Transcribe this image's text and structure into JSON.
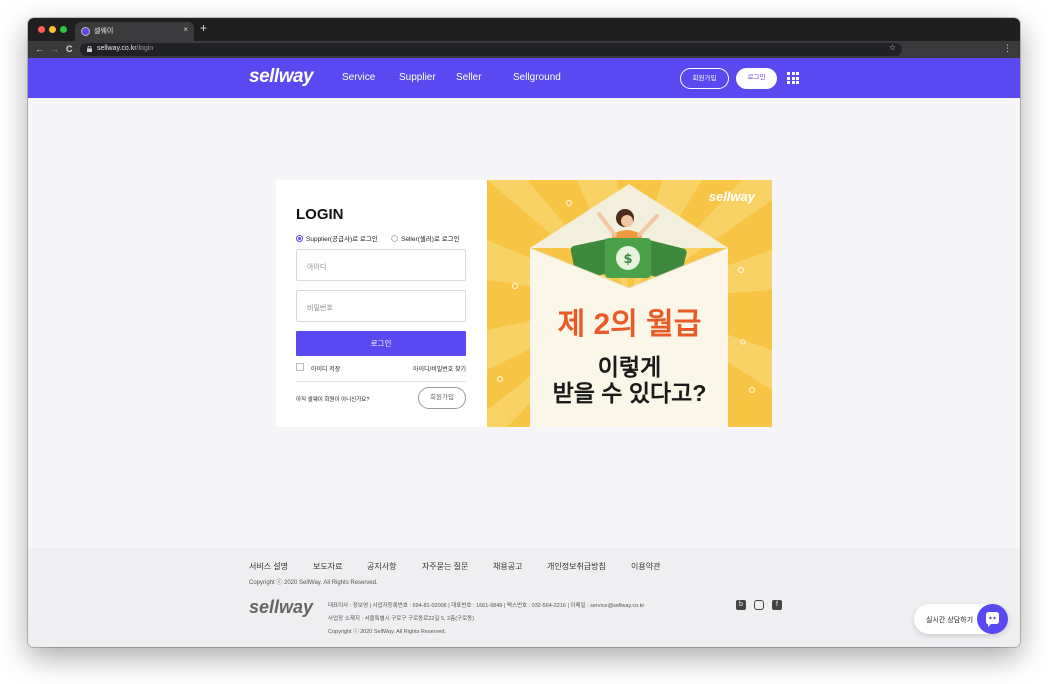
{
  "browser": {
    "tab_title": "셀웨이",
    "tab_close": "×",
    "new_tab": "+",
    "url_host": "sellway.co.kr",
    "url_path": "/login",
    "nav_back": "←",
    "nav_forward": "→",
    "nav_reload": "C",
    "star": "☆",
    "menu": "⋮"
  },
  "header": {
    "logo": "sellway",
    "nav": [
      "Service",
      "Supplier",
      "Seller",
      "Sellground"
    ],
    "signup_label": "회원가입",
    "login_label": "로그인"
  },
  "login": {
    "title": "LOGIN",
    "radio_supplier": "Supplier(공급사)로 로그인",
    "radio_seller": "Seller(셀러)로 로그인",
    "selected": "supplier",
    "id_placeholder": "아이디",
    "password_placeholder": "비밀번호",
    "submit_label": "로그인",
    "remember_label": "아이디 저장",
    "find_label": "아이디/비밀번호 찾기",
    "not_member": "아직 셀웨이 회원이 아니신가요?",
    "signup_label": "회원가입"
  },
  "banner": {
    "logo": "sellway",
    "headline": "제 2의 월급",
    "subline_1": "이렇게",
    "subline_2": "받을 수 있다고?",
    "bg_color": "#f7c543",
    "headline_color": "#ea5a27"
  },
  "footer": {
    "links": [
      "서비스 설명",
      "보도자료",
      "공지사항",
      "자주묻는 질문",
      "채용공고",
      "개인정보취급방침",
      "이용약관"
    ],
    "copyright": "Copyright ⓒ 2020 SellWay. All Rights Reserved.",
    "logo": "sellway",
    "info_line_1": "대표이사 : 장보영 | 사업자등록번호 : 694-81-02006 | 대표번호 : 1661-9849 | 팩스번호 : 032-564-2216 | 이메일 : service@sellway.co.kr",
    "info_line_2": "사업장 소재지 : 서울특별시 구로구 구로동로22길 5, 2층(구로동)",
    "info_line_3": "Copyright ⓒ 2020 SellWay. All Rights Reserved.",
    "social_icons": [
      "blog-icon",
      "instagram-icon",
      "facebook-icon"
    ],
    "chat_label": "실시간 상담하기"
  },
  "colors": {
    "brand": "#5a48f0"
  }
}
